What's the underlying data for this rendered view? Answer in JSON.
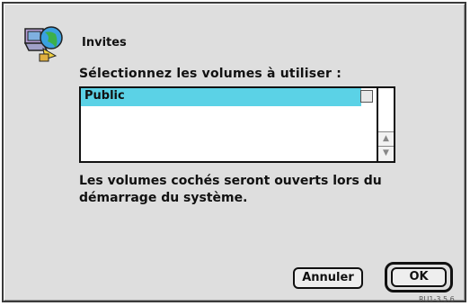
{
  "dialog": {
    "title": "Invites",
    "prompt": "Sélectionnez les volumes à utiliser :",
    "help_text": "Les volumes cochés seront ouverts lors du démarrage du système.",
    "reference": "RU1-3.5.6"
  },
  "volume_list": {
    "items": [
      {
        "label": "Public",
        "selected": true,
        "checked": false
      }
    ]
  },
  "buttons": {
    "cancel_label": "Annuler",
    "ok_label": "OK"
  },
  "icons": {
    "app_icon": "file-sharing-globe-icon",
    "selection_color": "#5bd2e6"
  }
}
